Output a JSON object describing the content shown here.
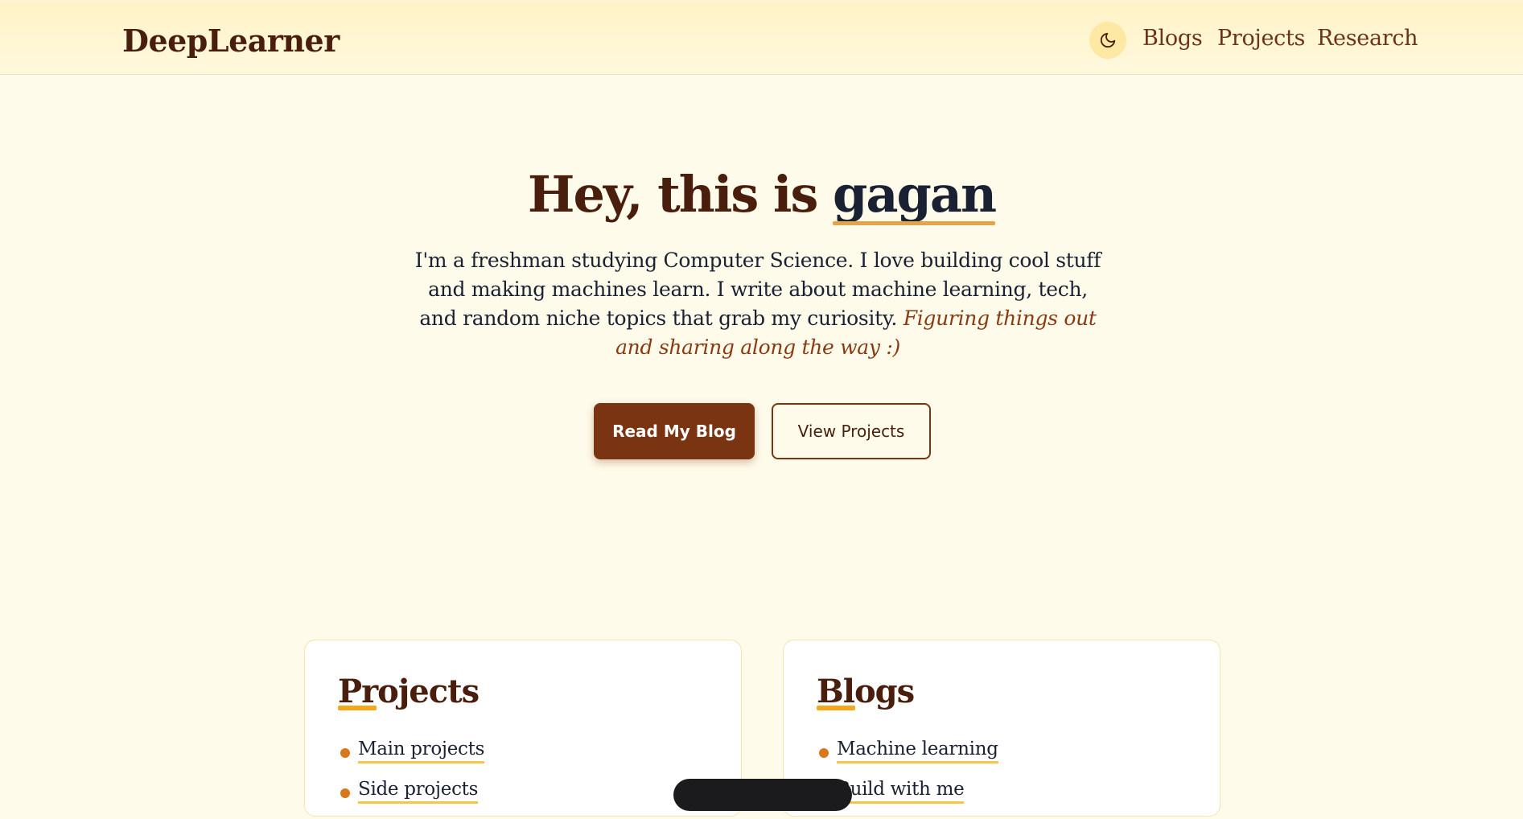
{
  "nav": {
    "brand": "DeepLearner",
    "theme_toggle_icon": "moon-icon",
    "links": [
      "Blogs",
      "Projects",
      "Research"
    ]
  },
  "hero": {
    "title_prefix": "Hey, this is ",
    "title_name": "gagan",
    "description": "I'm a freshman studying Computer Science. I love building cool stuff and making machines learn. I write about machine learning, tech, and random niche topics that grab my curiosity.",
    "tagline": "Figuring things out and sharing along the way :)",
    "primary_button": "Read My Blog",
    "secondary_button": "View Projects"
  },
  "cards": {
    "projects": {
      "title": "Projects",
      "items": [
        "Main projects",
        "Side projects"
      ]
    },
    "blogs": {
      "title": "Blogs",
      "items": [
        "Machine learning",
        "Build with me"
      ]
    }
  },
  "colors": {
    "background": "#fffbea",
    "brand_brown": "#7a3412",
    "accent_orange": "#d9771c",
    "underline_yellow": "#f5c747"
  }
}
